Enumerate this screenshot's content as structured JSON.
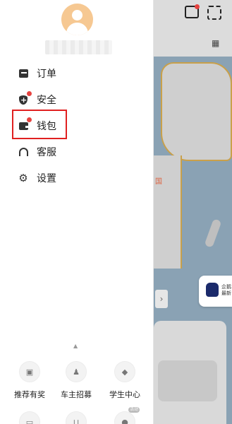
{
  "app": {
    "accent_color": "#e02020",
    "badge_color": "#e64340",
    "avatar_color": "#f6c892"
  },
  "drawer": {
    "menu": [
      {
        "label": "订单",
        "icon": "order-icon"
      },
      {
        "label": "安全",
        "icon": "shield-icon",
        "has_dot": true
      },
      {
        "label": "钱包",
        "icon": "wallet-icon",
        "has_dot": true,
        "highlighted": true
      },
      {
        "label": "客服",
        "icon": "headset-icon"
      },
      {
        "label": "设置",
        "icon": "gear-icon"
      }
    ],
    "shortcuts": [
      {
        "label": "推荐有奖",
        "icon": "gift-icon"
      },
      {
        "label": "车主招募",
        "icon": "driver-icon"
      },
      {
        "label": "学生中心",
        "icon": "graduation-cap-icon"
      }
    ],
    "shortcuts_row2": [
      {
        "icon": "bag-icon"
      },
      {
        "icon": "cart-icon"
      },
      {
        "icon": "coin-icon",
        "badge": "活动"
      }
    ]
  },
  "map": {
    "region_label": "国",
    "promo_text_line1": "企鹅",
    "promo_text_line2": "最新"
  }
}
